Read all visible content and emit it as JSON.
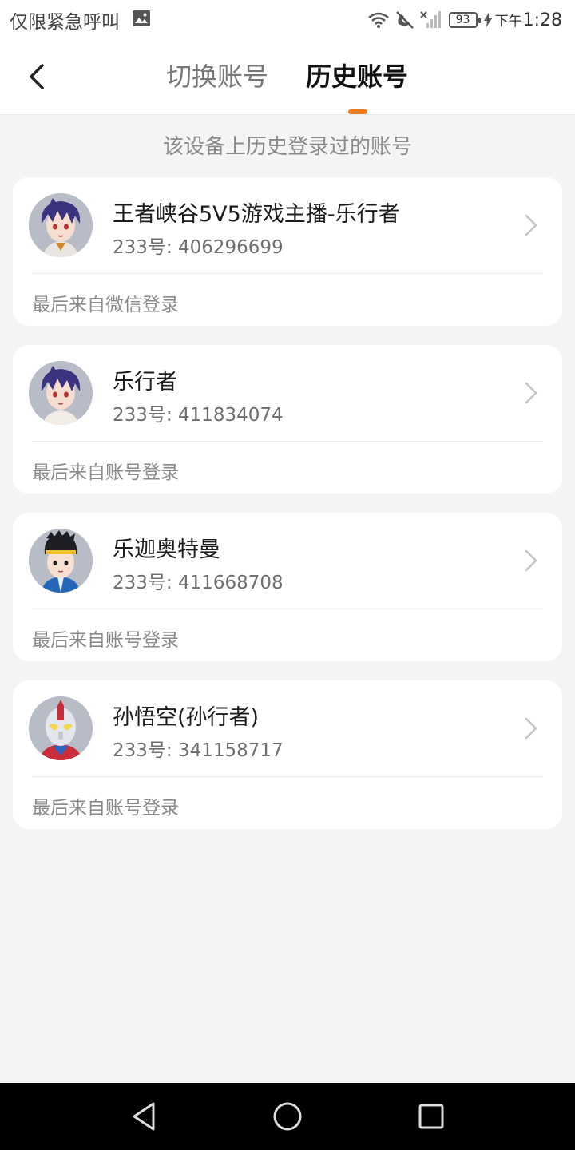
{
  "status_bar": {
    "carrier_text": "仅限紧急呼叫",
    "battery": "93",
    "time_period": "下午",
    "time": "1:28"
  },
  "nav": {
    "tab_switch": "切换账号",
    "tab_history": "历史账号",
    "accent_color": "#f07a1b"
  },
  "subtitle": "该设备上历史登录过的账号",
  "accounts": [
    {
      "name": "王者峡谷5V5游戏主播-乐行者",
      "id_text": "233号: 406296699",
      "source": "最后来自微信登录",
      "avatar": "anime-purple-hair-avatar"
    },
    {
      "name": "乐行者",
      "id_text": "233号: 411834074",
      "source": "最后来自账号登录",
      "avatar": "anime-purple-hair-avatar"
    },
    {
      "name": "乐迦奥特曼",
      "id_text": "233号: 411668708",
      "source": "最后来自账号登录",
      "avatar": "anime-black-hair-headband-avatar"
    },
    {
      "name": "孙悟空(孙行者)",
      "id_text": "233号: 341158717",
      "source": "最后来自账号登录",
      "avatar": "ultraman-avatar"
    }
  ]
}
